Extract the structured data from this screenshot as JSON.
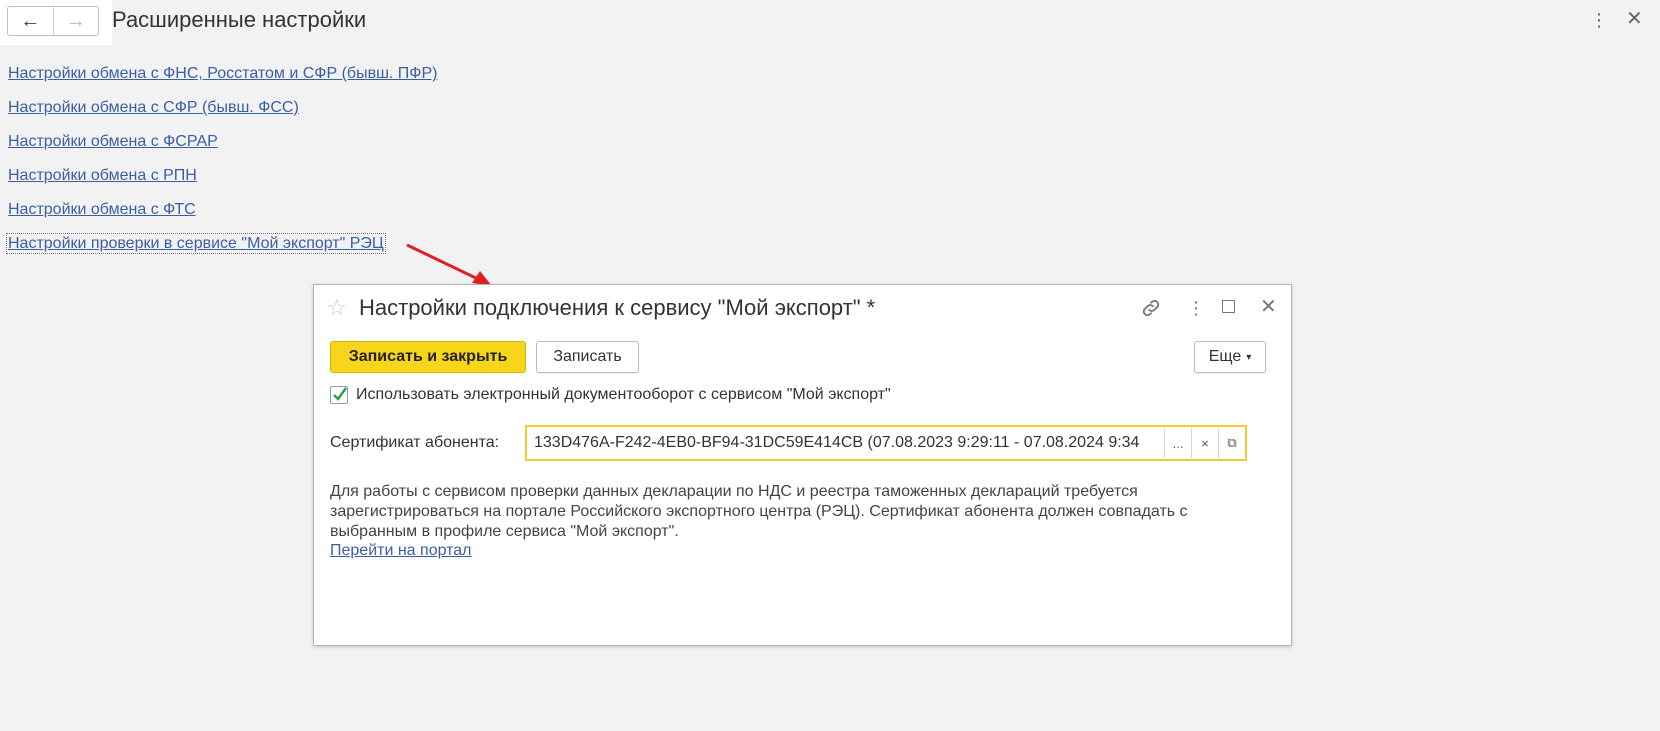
{
  "header": {
    "title": "Расширенные настройки",
    "back_icon": "←",
    "forward_icon": "→",
    "more_icon": "⋮",
    "close_icon": "✕"
  },
  "links": [
    "Настройки обмена с ФНС, Росстатом и СФР (бывш. ПФР)",
    "Настройки обмена с СФР (бывш. ФСС)",
    "Настройки обмена с ФСРАР",
    "Настройки обмена с РПН",
    "Настройки обмена с ФТС",
    "Настройки проверки в сервисе \"Мой экспорт\" РЭЦ"
  ],
  "dialog": {
    "title": "Настройки подключения к сервису \"Мой экспорт\" *",
    "star_icon": "☆",
    "link_icon": "🔗",
    "more_icon": "⋮",
    "close_icon": "✕",
    "save_close_label": "Записать и закрыть",
    "save_label": "Записать",
    "more_label": "Еще",
    "more_caret": "▾",
    "checkbox_label": "Использовать электронный документооборот с сервисом \"Мой экспорт\"",
    "checkbox_checked": true,
    "cert_label": "Сертификат абонента:",
    "cert_value": "133D476A-F242-4EB0-BF94-31DC59E414CB (07.08.2023 9:29:11 - 07.08.2024 9:34",
    "cert_select_icon": "...",
    "cert_clear_icon": "×",
    "cert_open_icon": "⧉",
    "info_text": "Для работы с сервисом проверки данных декларации по НДС и реестра таможенных деклараций требуется зарегистрироваться на портале Российского экспортного центра (РЭЦ). Сертификат абонента должен совпадать с выбранным в профиле сервиса \"Мой экспорт\".",
    "portal_link": "Перейти на портал"
  },
  "colors": {
    "accent_button": "#f7d51b",
    "link": "#3a5fa5",
    "field_focus": "#f2cd32",
    "check": "#2e9d4c",
    "arrow": "#e02020"
  }
}
